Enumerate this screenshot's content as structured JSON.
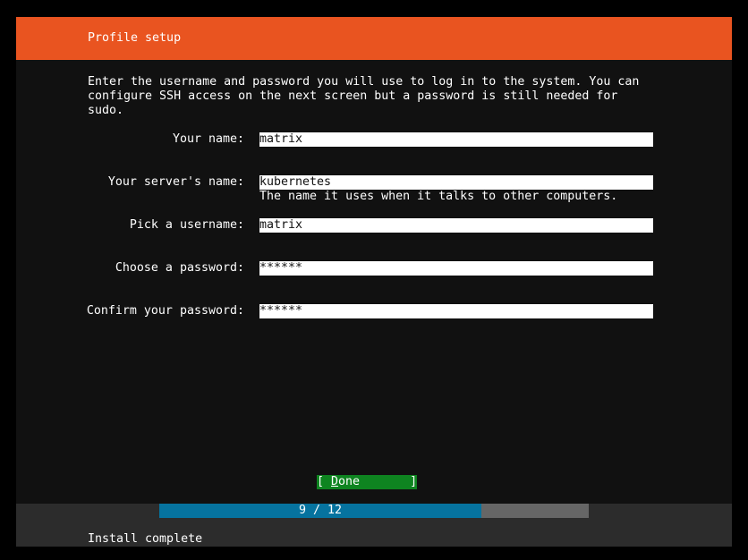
{
  "header": {
    "title": "Profile setup",
    "color": "#e95420"
  },
  "intro": {
    "text": "Enter the username and password you will use to log in to the system. You can\nconfigure SSH access on the next screen but a password is still needed for\nsudo."
  },
  "form": {
    "your_name": {
      "label": "Your name:",
      "value": "matrix"
    },
    "server_name": {
      "label": "Your server's name:",
      "value": "kubernetes",
      "help": "The name it uses when it talks to other computers."
    },
    "username": {
      "label": "Pick a username:",
      "value": "matrix"
    },
    "password": {
      "label": "Choose a password:",
      "value": "******"
    },
    "confirm_password": {
      "label": "Confirm your password:",
      "value": "******"
    }
  },
  "done_button": {
    "label_open": "[ ",
    "label_hotkey": "D",
    "label_rest": "one",
    "label_close": "       ]",
    "color": "#0e8420"
  },
  "progress": {
    "text": "9 / 12",
    "current": 9,
    "total": 12,
    "fill_color": "#06739f",
    "track_color": "#666666"
  },
  "status": {
    "text": "Install complete"
  }
}
